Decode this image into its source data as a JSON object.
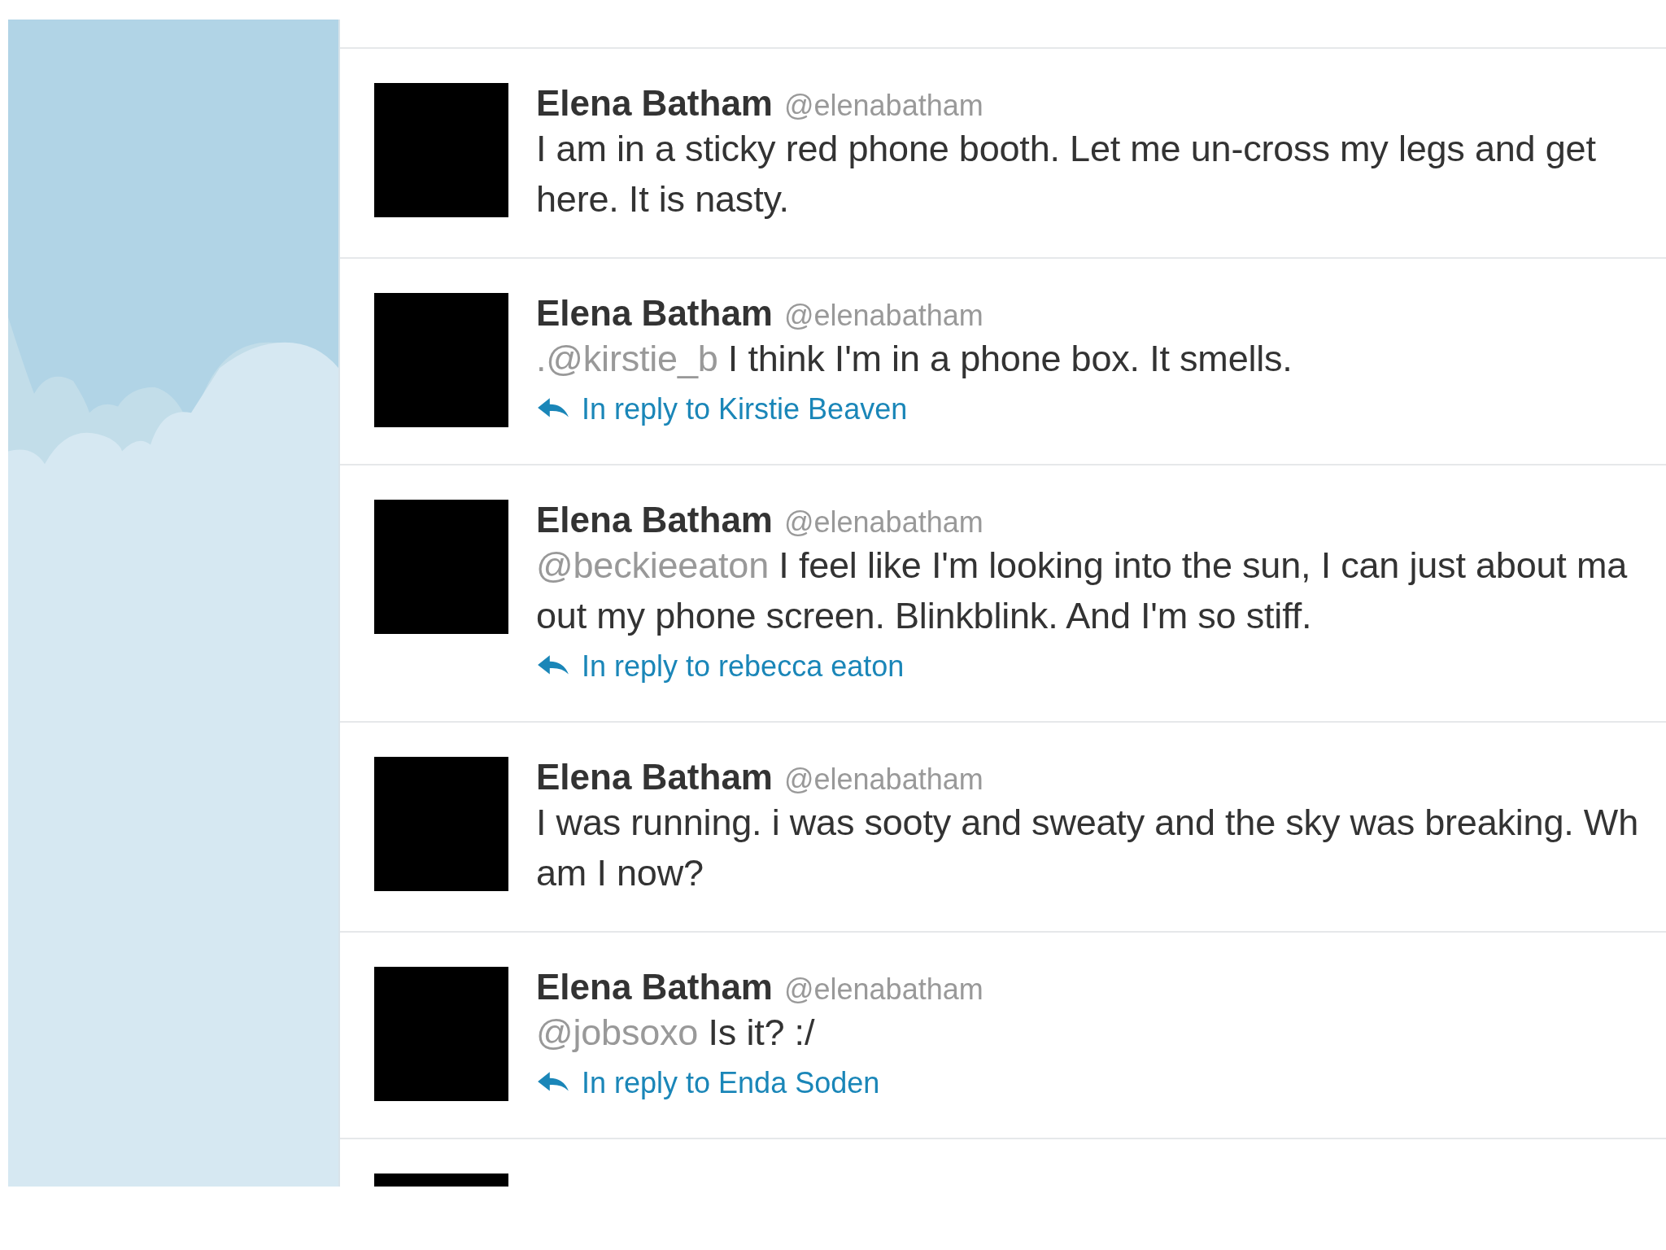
{
  "tweets": [
    {
      "name": "Elena Batham",
      "handle": "@elenabatham",
      "lines": [
        "I am in a sticky red phone booth. Let me un-cross my legs and get",
        "here. It is nasty."
      ]
    },
    {
      "name": "Elena Batham",
      "handle": "@elenabatham",
      "mention": ".@kirstie_b",
      "lines": [
        "I think I'm in a phone box. It smells."
      ],
      "reply": "In reply to Kirstie Beaven"
    },
    {
      "name": "Elena Batham",
      "handle": "@elenabatham",
      "mention": "@beckieeaton",
      "lines": [
        "I feel like I'm looking into the sun, I can just about ma",
        "out my phone screen. Blinkblink. And I'm so stiff."
      ],
      "reply": "In reply to rebecca eaton"
    },
    {
      "name": "Elena Batham",
      "handle": "@elenabatham",
      "lines": [
        "I was running. i was sooty and sweaty and the sky was breaking. Wh",
        "am I now?"
      ]
    },
    {
      "name": "Elena Batham",
      "handle": "@elenabatham",
      "mention": "@jobsoxo",
      "lines": [
        "Is it? :/"
      ],
      "reply": "In reply to Enda Soden"
    }
  ]
}
